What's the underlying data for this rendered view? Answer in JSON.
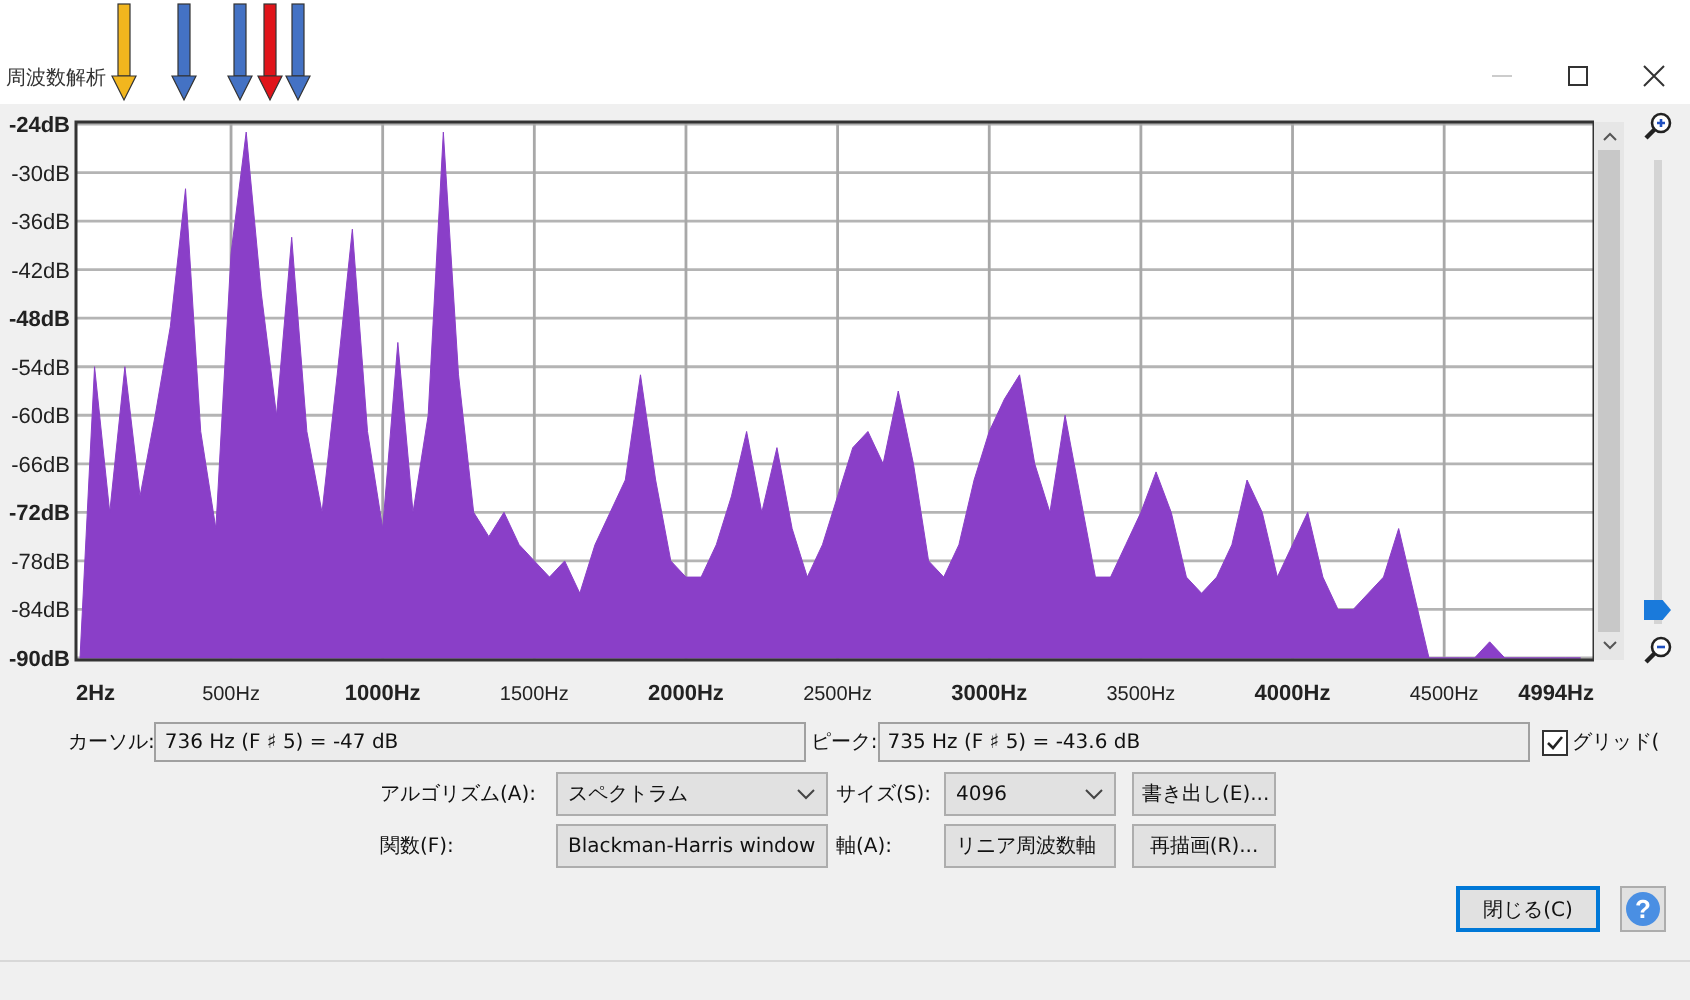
{
  "window": {
    "title": "周波数解析"
  },
  "spectrum": {
    "chart_data": {
      "type": "area",
      "x": [
        2,
        50,
        100,
        150,
        200,
        250,
        300,
        350,
        400,
        450,
        500,
        550,
        600,
        650,
        700,
        750,
        800,
        850,
        900,
        950,
        1000,
        1050,
        1100,
        1150,
        1200,
        1250,
        1300,
        1350,
        1400,
        1450,
        1500,
        1550,
        1600,
        1650,
        1700,
        1750,
        1800,
        1850,
        1900,
        1950,
        2000,
        2050,
        2100,
        2150,
        2200,
        2250,
        2300,
        2350,
        2400,
        2450,
        2500,
        2550,
        2600,
        2650,
        2700,
        2750,
        2800,
        2850,
        2900,
        2950,
        3000,
        3050,
        3100,
        3150,
        3200,
        3250,
        3300,
        3350,
        3400,
        3450,
        3500,
        3550,
        3600,
        3650,
        3700,
        3750,
        3800,
        3850,
        3900,
        3950,
        4000,
        4050,
        4100,
        4150,
        4200,
        4250,
        4300,
        4350,
        4400,
        4450,
        4500,
        4550,
        4600,
        4650,
        4700,
        4750,
        4800,
        4850,
        4900,
        4950
      ],
      "series": [
        {
          "color": "#8a3fc8",
          "values": [
            -90,
            -54,
            -72,
            -54,
            -70,
            -60,
            -49,
            -32,
            -62,
            -74,
            -40,
            -25,
            -45,
            -60,
            -38,
            -62,
            -72,
            -55,
            -37,
            -62,
            -74,
            -51,
            -72,
            -60,
            -25,
            -55,
            -72,
            -75,
            -72,
            -76,
            -78,
            -80,
            -78,
            -82,
            -76,
            -72,
            -68,
            -55,
            -68,
            -78,
            -80,
            -80,
            -76,
            -70,
            -62,
            -72,
            -64,
            -74,
            -80,
            -76,
            -70,
            -64,
            -62,
            -66,
            -57,
            -66,
            -78,
            -80,
            -76,
            -68,
            -62,
            -58,
            -55,
            -66,
            -72,
            -60,
            -70,
            -80,
            -80,
            -76,
            -72,
            -67,
            -72,
            -80,
            -82,
            -80,
            -76,
            -68,
            -72,
            -80,
            -76,
            -72,
            -80,
            -84,
            -84,
            -82,
            -80,
            -74,
            -82,
            -90,
            -90,
            -90,
            -90,
            -88,
            -90,
            -90,
            -90,
            -90,
            -90,
            -90
          ]
        }
      ],
      "xlim": [
        2,
        4994
      ],
      "ylim": [
        -90,
        -24
      ],
      "grid": true,
      "xticks": [
        {
          "value": 2,
          "label": "2Hz"
        },
        {
          "value": 500,
          "label": "500Hz"
        },
        {
          "value": 1000,
          "label": "1000Hz"
        },
        {
          "value": 1500,
          "label": "1500Hz"
        },
        {
          "value": 2000,
          "label": "2000Hz"
        },
        {
          "value": 2500,
          "label": "2500Hz"
        },
        {
          "value": 3000,
          "label": "3000Hz"
        },
        {
          "value": 3500,
          "label": "3500Hz"
        },
        {
          "value": 4000,
          "label": "4000Hz"
        },
        {
          "value": 4500,
          "label": "4500Hz"
        },
        {
          "value": 4994,
          "label": "4994Hz"
        }
      ],
      "yticks": [
        {
          "value": -24,
          "label": "-24dB"
        },
        {
          "value": -30,
          "label": "-30dB"
        },
        {
          "value": -36,
          "label": "-36dB"
        },
        {
          "value": -42,
          "label": "-42dB"
        },
        {
          "value": -48,
          "label": "-48dB"
        },
        {
          "value": -54,
          "label": "-54dB"
        },
        {
          "value": -60,
          "label": "-60dB"
        },
        {
          "value": -66,
          "label": "-66dB"
        },
        {
          "value": -72,
          "label": "-72dB"
        },
        {
          "value": -78,
          "label": "-78dB"
        },
        {
          "value": -84,
          "label": "-84dB"
        },
        {
          "value": -90,
          "label": "-90dB"
        }
      ]
    }
  },
  "marker_arrows": [
    {
      "color": "#f2b61e"
    },
    {
      "color": "#4472c4"
    },
    {
      "color": "#4472c4"
    },
    {
      "color": "#e0141a"
    },
    {
      "color": "#4472c4"
    }
  ],
  "zoom_slider": {
    "level": 0
  },
  "readouts": [
    {
      "label": "カーソル:",
      "value": "736 Hz (F ♯ 5) = -47 dB"
    },
    {
      "label": "ピーク:",
      "value": "735 Hz (F ♯ 5) = -43.6 dB"
    }
  ],
  "grid_checkbox": {
    "label": "グリッド(",
    "checked": true
  },
  "settings": [
    {
      "label": "アルゴリズム(A):",
      "value": "スペクトラム"
    },
    {
      "label": "サイズ(S):",
      "value": "4096"
    },
    {
      "label": "関数(F):",
      "value": "Blackman-Harris window"
    },
    {
      "label": "軸(A):",
      "value": "リニア周波数軸"
    }
  ],
  "action_buttons": [
    "書き出し(E)...",
    "再描画(R)..."
  ],
  "footer_buttons": [
    {
      "kind": "default",
      "label": "閉じる(C)"
    },
    {
      "kind": "help",
      "label": "?"
    }
  ]
}
